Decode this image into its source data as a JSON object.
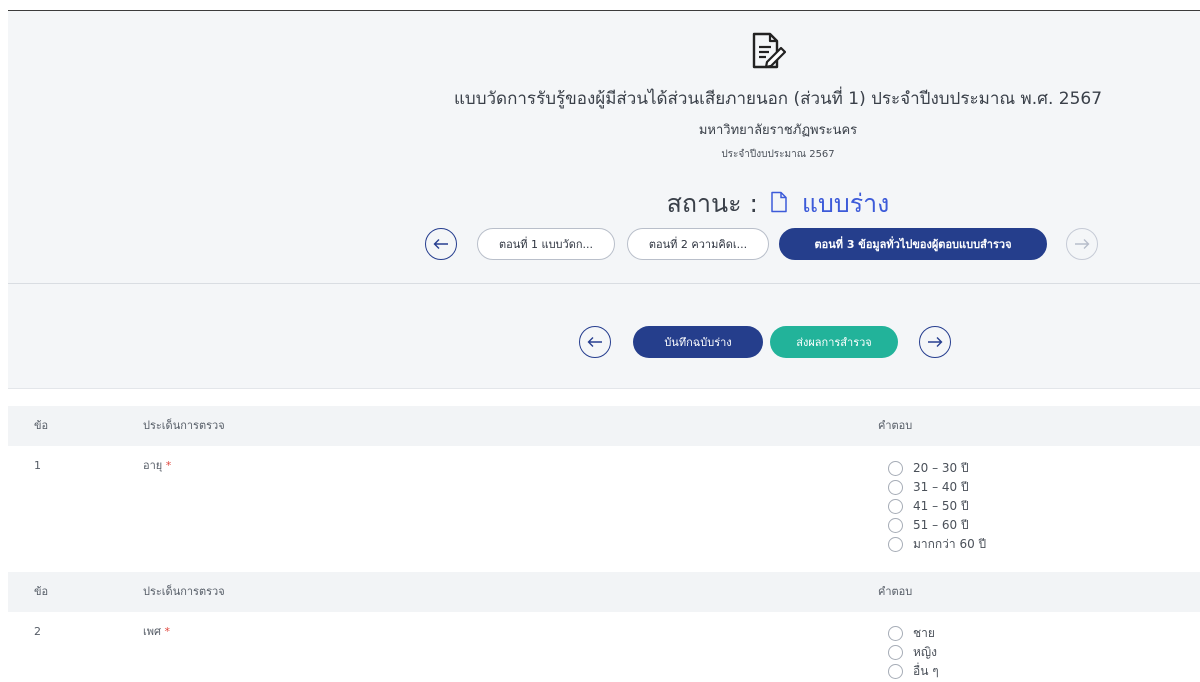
{
  "survey": {
    "title": "แบบวัดการรับรู้ของผู้มีส่วนได้ส่วนเสียภายนอก (ส่วนที่ 1) ประจำปีงบประมาณ พ.ศ. 2567",
    "organization": "มหาวิทยาลัยราชภัฏพระนคร",
    "fiscal_year": "ประจำปีงบประมาณ 2567",
    "status_label": "สถานะ :",
    "status_value": "แบบร่าง"
  },
  "parts": [
    {
      "label": "ตอนที่ 1 แบบวัดก...",
      "active": false
    },
    {
      "label": "ตอนที่ 2 ความคิดเ...",
      "active": false
    },
    {
      "label": "ตอนที่ 3 ข้อมูลทั่วไปของผู้ตอบแบบสำรวจ",
      "active": true
    }
  ],
  "actions": {
    "save_draft": "บันทึกฉบับร่าง",
    "submit": "ส่งผลการสำรวจ"
  },
  "table": {
    "headers": {
      "no": "ข้อ",
      "issue": "ประเด็นการตรวจ",
      "answer": "คำตอบ"
    },
    "questions": [
      {
        "no": "1",
        "text": "อายุ",
        "required_mark": "*",
        "options": [
          "20 – 30 ปี",
          "31 – 40 ปี",
          "41 – 50 ปี",
          "51 – 60 ปี",
          "มากกว่า 60 ปี"
        ]
      },
      {
        "no": "2",
        "text": "เพศ",
        "required_mark": "*",
        "options": [
          "ชาย",
          "หญิง",
          "อื่น ๆ"
        ]
      }
    ]
  },
  "icons": {
    "document": "document-edit-icon",
    "status": "file-icon",
    "prev": "arrow-left-icon",
    "next": "arrow-right-icon"
  },
  "colors": {
    "primary": "#253e8c",
    "success": "#22b39a",
    "status_text": "#3d5bd9",
    "required": "#e0463d",
    "header_bg": "#f4f6f8"
  }
}
